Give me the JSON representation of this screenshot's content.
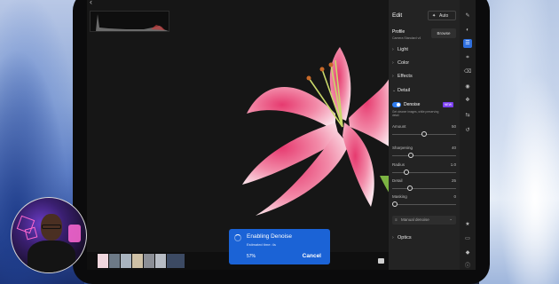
{
  "panel": {
    "title": "Edit",
    "auto_label": "Auto",
    "profile_label": "Profile",
    "profile_value": "Camera Standard v4",
    "browse_label": "Browse",
    "sections": [
      "Light",
      "Color",
      "Effects",
      "Detail"
    ],
    "denoise_label": "Denoise",
    "new_badge": "NEW",
    "denoise_desc": "Get cleaner images, while preserving detail",
    "sliders": [
      {
        "label": "Amount",
        "value": "50",
        "level": 0.5
      },
      {
        "label": "Sharpening",
        "value": "40",
        "level": 0.27
      },
      {
        "label": "Radius",
        "value": "1.0",
        "level": 0.2
      },
      {
        "label": "Detail",
        "value": "25",
        "level": 0.25
      },
      {
        "label": "Masking",
        "value": "0",
        "level": 0.0
      }
    ],
    "manual_denoise": "Manual denoise",
    "optics_label": "Optics"
  },
  "toast": {
    "title": "Enabling Denoise",
    "subtitle": "Estimated time: 4s",
    "percent": "57%",
    "cancel_label": "Cancel"
  },
  "colors": {
    "accent": "#2f6fde",
    "toast": "#1b63d6",
    "new_badge": "#7b3ff0",
    "panel": "#232323",
    "canvas": "#161616"
  },
  "icons": {
    "rail": [
      "brush-icon",
      "mask-icon",
      "sliders-icon",
      "crop-icon",
      "eraser-icon",
      "redeye-icon",
      "presets-icon",
      "versions-icon",
      "history-icon",
      "star-icon",
      "comment-icon",
      "tag-icon",
      "info-icon"
    ]
  }
}
